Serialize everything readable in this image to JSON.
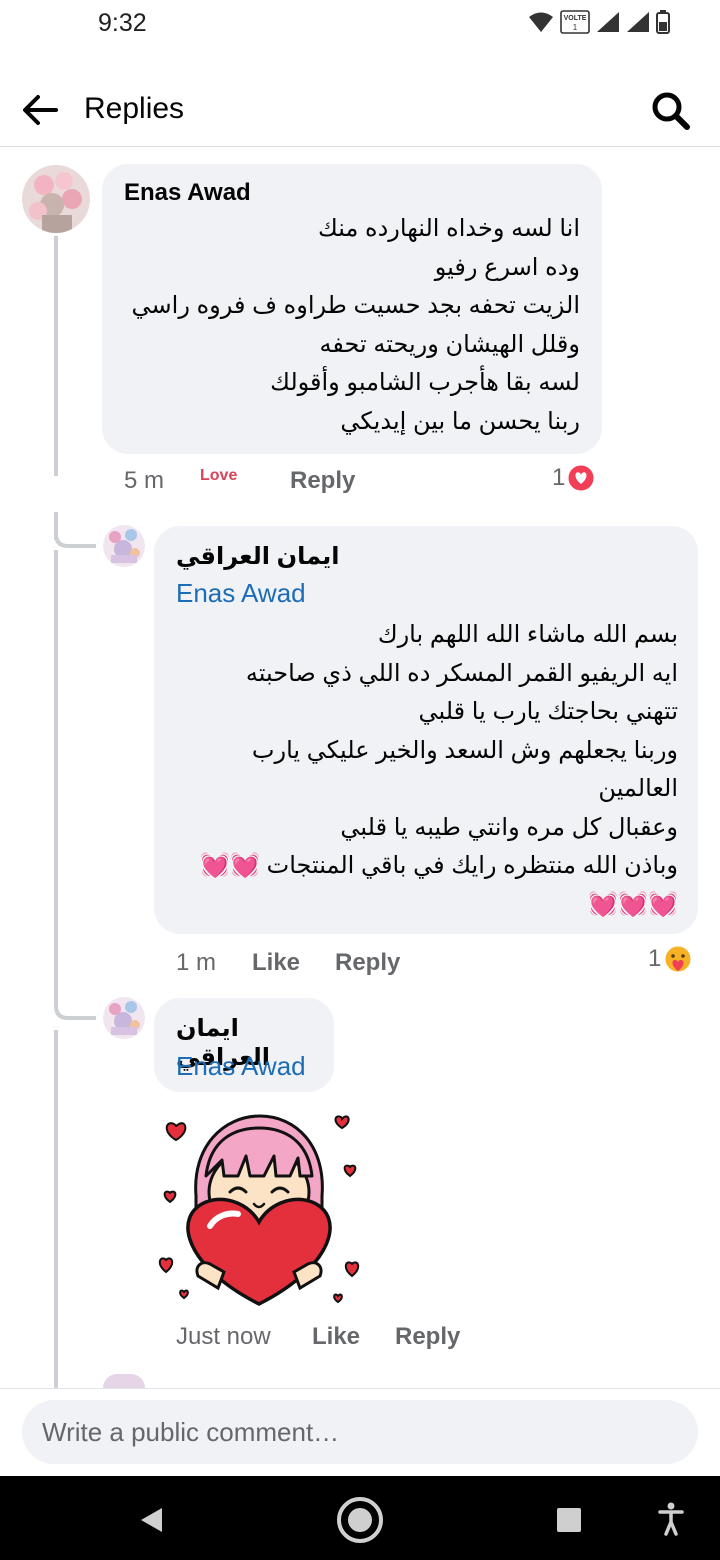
{
  "status_bar": {
    "time": "9:32",
    "volte_label": "VOLTE",
    "sim_label": "1"
  },
  "header": {
    "title": "Replies"
  },
  "comments": [
    {
      "author": "Enas Awad",
      "lines": [
        "انا لسه وخداه النهارده منك",
        "وده اسرع رفيو",
        "الزيت تحفه بجد حسيت طراوه ف فروه راسي",
        "وقلل الهيشان وريحته تحفه",
        "لسه بقا هأجرب الشامبو وأقولك",
        "ربنا يحسن ما بين إيديكي"
      ],
      "time": "5 m",
      "reaction_label": "Love",
      "reply_label": "Reply",
      "reaction_count": "1"
    },
    {
      "author": "ايمان العراقي",
      "mention": "Enas Awad",
      "lines": [
        "بسم الله ماشاء الله اللهم بارك",
        "ايه الريفيو القمر المسكر ده اللي ذي صاحبته",
        "تتهني بحاجتك يارب يا قلبي",
        "وربنا يجعلهم وش السعد والخير عليكي يارب",
        "العالمين",
        "وعقبال كل مره وانتي طيبه يا قلبي",
        "وباذن الله منتظره رايك في باقي المنتجات 💓💓"
      ],
      "emoji_line": "💓💓💓",
      "time": "1 m",
      "like_label": "Like",
      "reply_label": "Reply",
      "reaction_count": "1"
    },
    {
      "author": "ايمان العراقي",
      "mention": "Enas Awad",
      "time": "Just now",
      "like_label": "Like",
      "reply_label": "Reply"
    }
  ],
  "composer": {
    "placeholder": "Write a public comment…"
  },
  "colors": {
    "bubble": "#f0f2f5",
    "link_blue": "#1c6db5",
    "love_red": "#d9435b",
    "meta_gray": "#65676b",
    "sticker_pink": "#f4a6c6",
    "sticker_heart": "#e4303d"
  },
  "icons": [
    "back-arrow-icon",
    "search-icon",
    "heart-reaction-icon",
    "care-reaction-icon",
    "nav-back-icon",
    "nav-home-icon",
    "nav-recents-icon",
    "accessibility-icon"
  ]
}
